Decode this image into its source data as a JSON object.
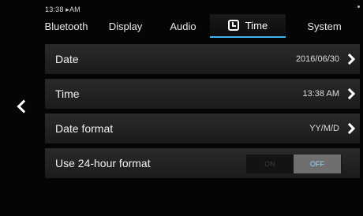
{
  "status": {
    "time": "13:38 ▸AM"
  },
  "tabs": [
    {
      "label": "Bluetooth"
    },
    {
      "label": "Display"
    },
    {
      "label": "Audio"
    },
    {
      "label": "Time",
      "icon": "clock-icon",
      "active": true
    },
    {
      "label": "System"
    }
  ],
  "back_icon": "chevron-left-icon",
  "settings": {
    "date": {
      "label": "Date",
      "value": "2016/06/30"
    },
    "time": {
      "label": "Time",
      "value": "13:38 AM"
    },
    "date_format": {
      "label": "Date format",
      "value": "YY/M/D"
    },
    "hour24": {
      "label": "Use 24-hour format",
      "on_label": "ON",
      "off_label": "OFF",
      "state": "OFF"
    }
  },
  "colors": {
    "accent": "#3fb3f0",
    "row_bg": "#222222",
    "background": "#050505"
  }
}
